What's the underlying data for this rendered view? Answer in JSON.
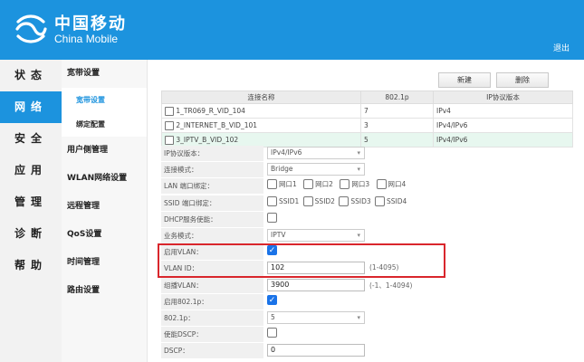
{
  "header": {
    "brand_cn": "中国移动",
    "brand_en": "China Mobile",
    "logout": "退出",
    "bg_color": "#1c93de"
  },
  "mainnav": [
    {
      "label": "状态",
      "active": false
    },
    {
      "label": "网络",
      "active": true
    },
    {
      "label": "安全",
      "active": false
    },
    {
      "label": "应用",
      "active": false
    },
    {
      "label": "管理",
      "active": false
    },
    {
      "label": "诊断",
      "active": false
    },
    {
      "label": "帮助",
      "active": false
    }
  ],
  "subnav": {
    "broadband": "宽带设置",
    "broadband_children": [
      "宽带设置",
      "绑定配置"
    ],
    "items": [
      "用户侧管理",
      "WLAN网络设置",
      "远程管理",
      "QoS设置",
      "时间管理",
      "路由设置"
    ]
  },
  "toolbar": {
    "new": "新建",
    "delete": "删除"
  },
  "table": {
    "headers": [
      "连接名称",
      "802.1p",
      "IP协议版本"
    ],
    "rows": [
      {
        "name": "1_TR069_R_VID_104",
        "p": "7",
        "ip": "IPv4",
        "selected": false
      },
      {
        "name": "2_INTERNET_B_VID_101",
        "p": "3",
        "ip": "IPv4/IPv6",
        "selected": false
      },
      {
        "name": "3_IPTV_B_VID_102",
        "p": "5",
        "ip": "IPv4/IPv6",
        "selected": true
      }
    ]
  },
  "form": {
    "ip_version": {
      "label": "IP协议版本：",
      "value": "IPv4/IPv6"
    },
    "conn_mode": {
      "label": "连接模式：",
      "value": "Bridge"
    },
    "lan_bind": {
      "label": "LAN 端口绑定：",
      "options": [
        "网口1",
        "网口2",
        "网口3",
        "网口4"
      ]
    },
    "ssid_bind": {
      "label": "SSID 端口绑定：",
      "options": [
        "SSID1",
        "SSID2",
        "SSID3",
        "SSID4"
      ]
    },
    "dhcp": {
      "label": "DHCP服务使能："
    },
    "service_mode": {
      "label": "业务模式：",
      "value": "IPTV"
    },
    "enable_vlan": {
      "label": "启用VLAN："
    },
    "vlan_id": {
      "label": "VLAN ID：",
      "value": "102",
      "hint": "(1-4095)"
    },
    "multicast_vlan": {
      "label": "组播VLAN：",
      "value": "3900",
      "hint": "(-1、1-4094)"
    },
    "enable_8021p": {
      "label": "启用802.1p："
    },
    "p8021": {
      "label": "802.1p：",
      "value": "5"
    },
    "enable_dscp": {
      "label": "使能DSCP："
    },
    "dscp": {
      "label": "DSCP：",
      "value": "0"
    }
  },
  "colors": {
    "accent": "#1c93de",
    "highlight": "#d9262c",
    "check": "#1a73e8"
  }
}
